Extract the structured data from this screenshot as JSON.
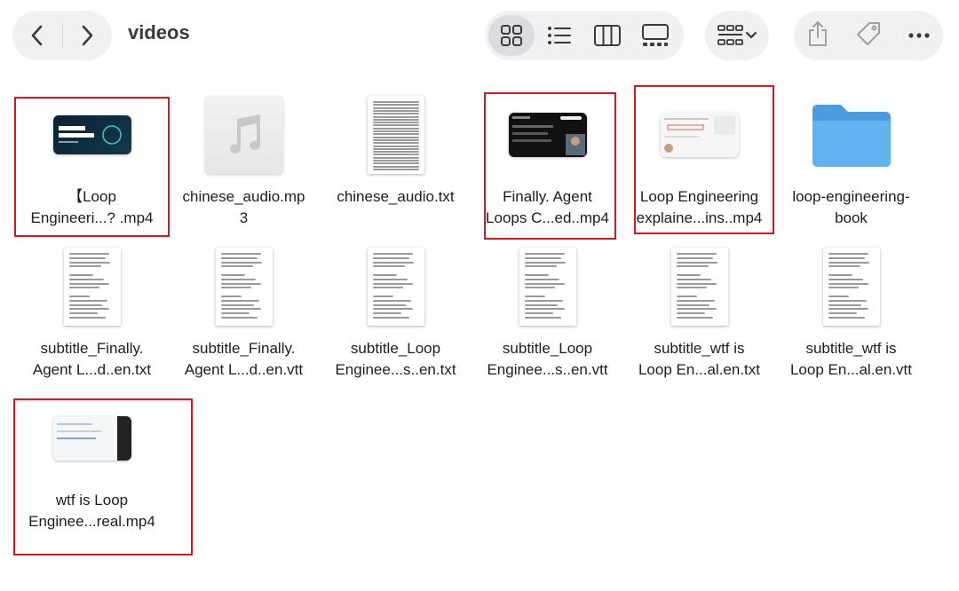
{
  "window": {
    "title": "videos"
  },
  "toolbar": {
    "back_icon": "chevron-left-icon",
    "forward_icon": "chevron-right-icon",
    "views": [
      "icon-view-icon",
      "list-view-icon",
      "column-view-icon",
      "gallery-view-icon"
    ],
    "active_view": 0,
    "group_icon": "group-by-icon",
    "share_icon": "share-icon",
    "tag_icon": "tag-icon",
    "more_icon": "more-icon"
  },
  "colors": {
    "highlight": "#e0141e",
    "folder": "#5aa8e8",
    "pill": "#f1f1f3"
  },
  "files": [
    {
      "label": "【Loop\nEngineeri...?  .mp4",
      "kind": "video",
      "highlighted": true
    },
    {
      "label": "chinese_audio.mp\n3",
      "kind": "audio",
      "highlighted": false
    },
    {
      "label": "chinese_audio.txt",
      "kind": "text-dense",
      "highlighted": false
    },
    {
      "label": "Finally. Agent\nLoops C...ed..mp4",
      "kind": "video",
      "highlighted": true
    },
    {
      "label": "Loop Engineering\nexplaine...ins..mp4",
      "kind": "video",
      "highlighted": true
    },
    {
      "label": "loop-engineering-\nbook",
      "kind": "folder",
      "highlighted": false
    },
    {
      "label": "subtitle_Finally.\nAgent L...d..en.txt",
      "kind": "text",
      "highlighted": false
    },
    {
      "label": "subtitle_Finally.\nAgent L...d..en.vtt",
      "kind": "text",
      "highlighted": false
    },
    {
      "label": "subtitle_Loop\nEnginee...s..en.txt",
      "kind": "text",
      "highlighted": false
    },
    {
      "label": "subtitle_Loop\nEnginee...s..en.vtt",
      "kind": "text",
      "highlighted": false
    },
    {
      "label": "subtitle_wtf is\nLoop En...al.en.txt",
      "kind": "text",
      "highlighted": false
    },
    {
      "label": "subtitle_wtf is\nLoop En...al.en.vtt",
      "kind": "text",
      "highlighted": false
    },
    {
      "label": "wtf is Loop\nEnginee...real.mp4",
      "kind": "video",
      "highlighted": true
    }
  ]
}
